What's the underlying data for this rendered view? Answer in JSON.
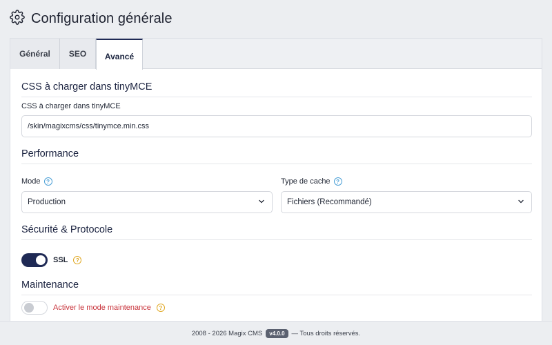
{
  "header": {
    "title": "Configuration générale",
    "icon": "gear-icon"
  },
  "tabs": [
    {
      "label": "Général",
      "active": false
    },
    {
      "label": "SEO",
      "active": false
    },
    {
      "label": "Avancé",
      "active": true
    }
  ],
  "css_section": {
    "title": "CSS à charger dans tinyMCE",
    "field_label": "CSS à charger dans tinyMCE",
    "field_value": "/skin/magixcms/css/tinymce.min.css"
  },
  "performance": {
    "title": "Performance",
    "mode_label": "Mode",
    "mode_value": "Production",
    "cache_label": "Type de cache",
    "cache_value": "Fichiers (Recommandé)"
  },
  "security": {
    "title": "Sécurité & Protocole",
    "ssl_label": "SSL",
    "ssl_enabled": true
  },
  "maintenance": {
    "title": "Maintenance",
    "toggle_label": "Activer le mode maintenance",
    "enabled": false
  },
  "footer": {
    "years": "2008 - 2026 Magix CMS",
    "version": "v4.0.0",
    "rights": "— Tous droits réservés."
  },
  "colors": {
    "accent": "#1f2a55",
    "help_blue": "#4a9fd6",
    "help_orange": "#e0a823",
    "warning_text": "#c8323a"
  }
}
